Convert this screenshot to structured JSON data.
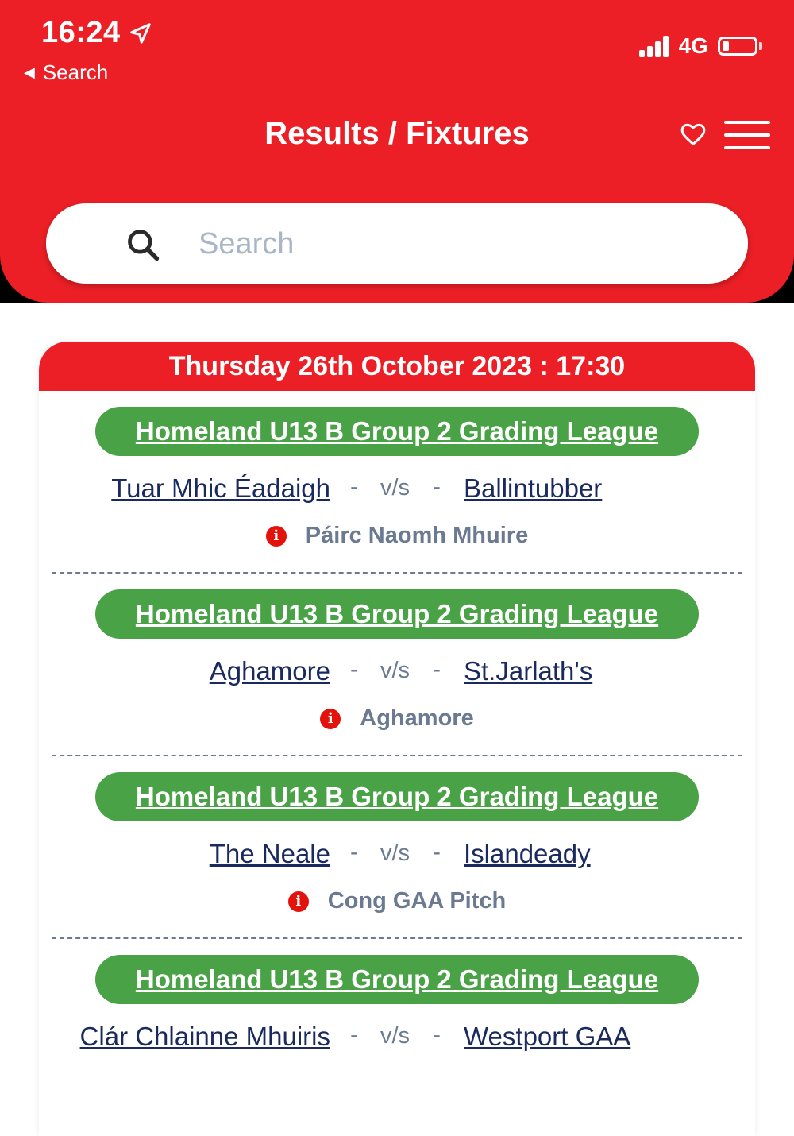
{
  "status_bar": {
    "time": "16:24",
    "back_label": "Search",
    "network": "4G"
  },
  "header": {
    "title": "Results / Fixtures",
    "search_placeholder": "Search"
  },
  "fixtures": {
    "date_heading": "Thursday 26th October 2023 : 17:30",
    "vs_label": "v/s",
    "separator": "-",
    "matches": [
      {
        "league": "Homeland U13 B Group 2 Grading League",
        "home": "Tuar Mhic Éadaigh",
        "away": "Ballintubber",
        "venue": "Páirc Naomh Mhuire"
      },
      {
        "league": "Homeland U13 B Group 2 Grading League",
        "home": "Aghamore",
        "away": "St.Jarlath's",
        "venue": "Aghamore"
      },
      {
        "league": "Homeland U13 B Group 2 Grading League",
        "home": "The Neale",
        "away": "Islandeady",
        "venue": "Cong GAA Pitch"
      },
      {
        "league": "Homeland U13 B Group 2 Grading League",
        "home": "Clár Chlainne Mhuiris",
        "away": "Westport GAA",
        "venue": ""
      }
    ]
  },
  "colors": {
    "brand_red": "#ec1f26",
    "league_green": "#4aa247",
    "team_text": "#1a2a5e",
    "muted_text": "#6b7a90"
  }
}
